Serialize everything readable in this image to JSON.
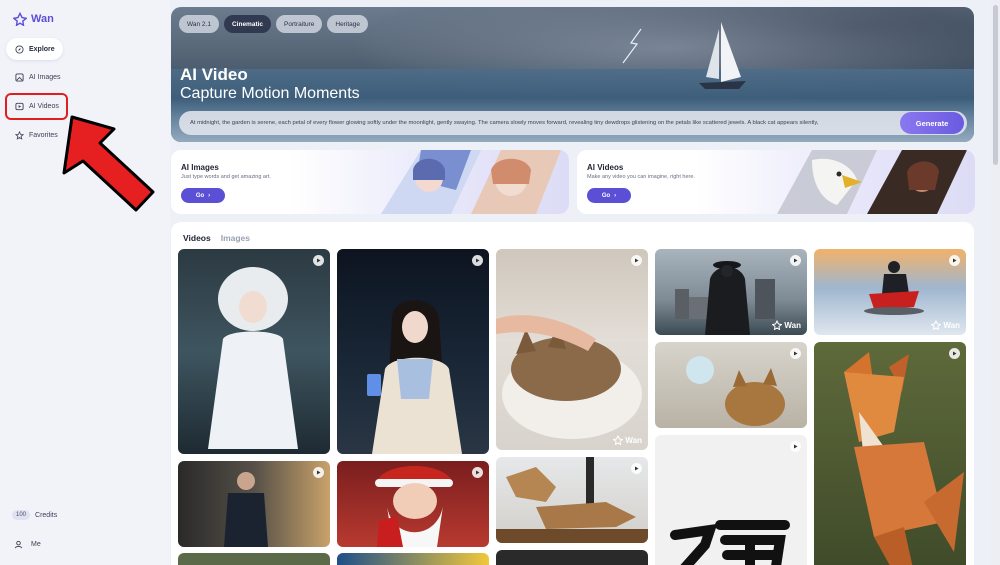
{
  "app": {
    "logo_text": "Wan",
    "accent": "#5b4fd6"
  },
  "sidebar": {
    "items": [
      {
        "label": "Explore",
        "icon": "compass-icon",
        "active": true
      },
      {
        "label": "AI Images",
        "icon": "image-icon",
        "active": false
      },
      {
        "label": "AI Videos",
        "icon": "video-icon",
        "active": false
      },
      {
        "label": "Favorites",
        "icon": "star-icon",
        "active": false
      }
    ],
    "credits_count": "100",
    "credits_label": "Credits",
    "me_label": "Me"
  },
  "hero": {
    "tabs": [
      "Wan 2.1",
      "Cinematic",
      "Portraiture",
      "Heritage"
    ],
    "active_tab": "Cinematic",
    "title": "AI Video",
    "subtitle": "Capture Motion Moments",
    "prompt": "At midnight, the garden is serene, each petal of every flower glowing softly under the moonlight, gently swaying. The camera slowly moves forward, revealing tiny dewdrops glistening on the petals like scattered jewels. A black cat appears silently,",
    "generate_label": "Generate"
  },
  "cards": [
    {
      "title": "AI Images",
      "desc": "Just type words and get amazing art.",
      "go_label": "Go"
    },
    {
      "title": "AI Videos",
      "desc": "Make any video you can imagine, right here.",
      "go_label": "Go"
    }
  ],
  "gallery": {
    "tabs": [
      "Videos",
      "Images"
    ],
    "watermark": "Wan"
  },
  "annotation": {
    "highlight_color": "#e02020"
  }
}
